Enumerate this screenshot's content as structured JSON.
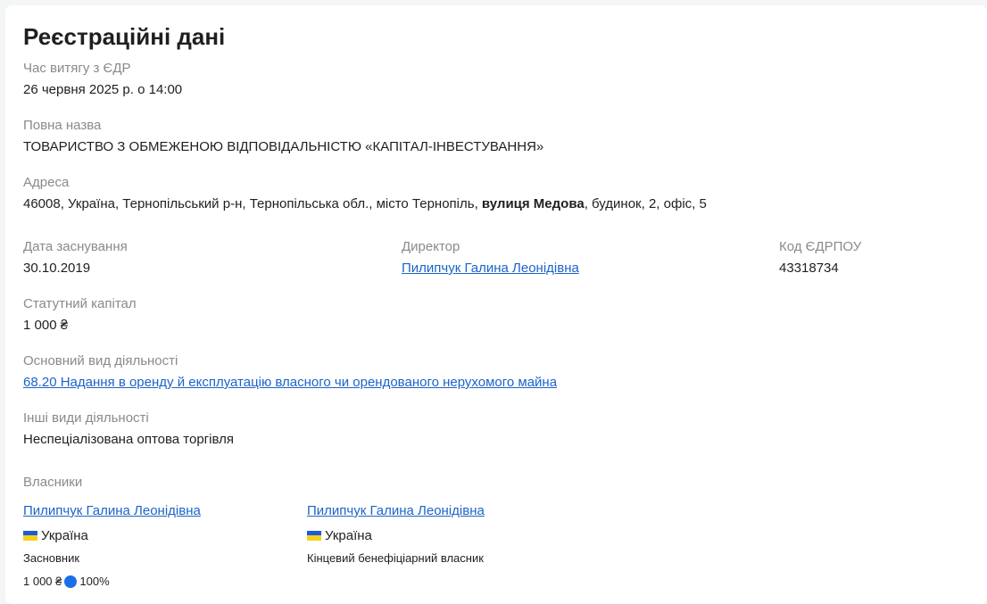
{
  "page": {
    "title": "Реєстраційні дані"
  },
  "extract_time": {
    "label": "Час витягу з ЄДР",
    "value": "26 червня 2025 р. о 14:00"
  },
  "full_name": {
    "label": "Повна назва",
    "value": "ТОВАРИСТВО З ОБМЕЖЕНОЮ ВІДПОВІДАЛЬНІСТЮ «КАПІТАЛ-ІНВЕСТУВАННЯ»"
  },
  "address": {
    "label": "Адреса",
    "prefix": "46008, Україна, Тернопільський р-н, Тернопільська обл., місто Тернопіль, ",
    "street": "вулиця Медова",
    "suffix": ", будинок, 2, офіс, 5"
  },
  "founded": {
    "label": "Дата заснування",
    "value": "30.10.2019"
  },
  "director": {
    "label": "Директор",
    "name": "Пилипчук Галина Леонідівна"
  },
  "edrpou": {
    "label": "Код ЄДРПОУ",
    "value": "43318734"
  },
  "capital": {
    "label": "Статутний капітал",
    "value": "1 000 ₴"
  },
  "main_activity": {
    "label": "Основний вид діяльності",
    "value": "68.20 Надання в оренду й експлуатацію власного чи орендованого нерухомого майна"
  },
  "other_activities": {
    "label": "Інші види діяльності",
    "value": "Неспеціалізована оптова торгівля"
  },
  "owners": {
    "label": "Власники",
    "items": [
      {
        "name": "Пилипчук Галина Леонідівна",
        "country": "Україна",
        "role": "Засновник",
        "amount": "1 000 ₴",
        "percent": "100%",
        "share_fraction": 1.0
      },
      {
        "name": "Пилипчук Галина Леонідівна",
        "country": "Україна",
        "role": "Кінцевий бенефіціарний власник"
      }
    ]
  },
  "colors": {
    "link": "#1c64c8",
    "label": "#8a8a8a",
    "text": "#1f1f1f",
    "share_pie": "#1a6fe8",
    "flag_blue": "#1f5bd6",
    "flag_yellow": "#f7d21c"
  },
  "icons": {
    "flag": "ukraine-flag-icon",
    "share": "share-pie-icon"
  }
}
